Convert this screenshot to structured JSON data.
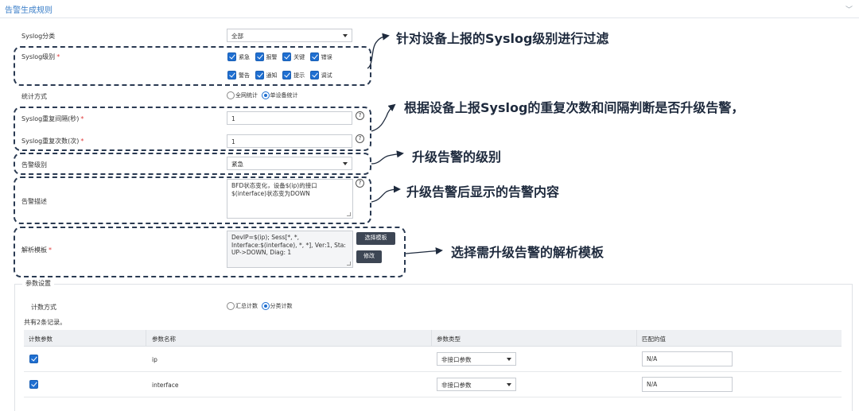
{
  "section": {
    "title": "告警生成规则"
  },
  "form": {
    "syslog_category": {
      "label": "Syslog分类",
      "value": "全部"
    },
    "syslog_level": {
      "label": "Syslog级别",
      "options": [
        "紧急",
        "报警",
        "关键",
        "错误",
        "警告",
        "通知",
        "提示",
        "调试"
      ],
      "checked": [
        true,
        true,
        true,
        true,
        true,
        true,
        true,
        true
      ]
    },
    "stat_mode": {
      "label": "统计方式",
      "options": [
        "全网统计",
        "单设备统计"
      ],
      "selected": "单设备统计"
    },
    "repeat_interval": {
      "label": "Syslog重复间隔(秒)",
      "value": "1"
    },
    "repeat_count": {
      "label": "Syslog重复次数(次)",
      "value": "1"
    },
    "alarm_level": {
      "label": "告警级别",
      "value": "紧急"
    },
    "alarm_desc": {
      "label": "告警描述",
      "value": "BFD状态变化，设备$(ip)的接口$(interface)状态变为DOWN"
    },
    "parse_template": {
      "label": "解析模板",
      "value": "DevIP=$(ip); Sess[*, *, Interface:$(interface), *, *], Ver:1, Sta: UP->DOWN, Diag: 1",
      "select_button": "选择模板",
      "edit_button": "修改"
    }
  },
  "annotations": [
    "针对设备上报的Syslog级别进行过滤",
    "根据设备上报Syslog的重复次数和间隔判断是否升级告警，",
    "升级告警的级别",
    "升级告警后显示的告警内容",
    "选择需升级告警的解析模板"
  ],
  "params": {
    "legend": "参数设置",
    "count_mode": {
      "label": "计数方式",
      "options": [
        "汇总计数",
        "分类计数"
      ],
      "selected": "分类计数"
    },
    "record_count": "共有2条记录。",
    "columns": [
      "计数参数",
      "参数名称",
      "参数类型",
      "匹配的值"
    ],
    "rows": [
      {
        "checked": true,
        "name": "ip",
        "type": "非接口参数",
        "match": "N/A"
      },
      {
        "checked": true,
        "name": "interface",
        "type": "非接口参数",
        "match": "N/A"
      }
    ]
  },
  "colors": {
    "accent": "#1f6fd1",
    "title": "#3a7ec8",
    "required": "#e03a3a",
    "annotation": "#1e2a3d"
  }
}
